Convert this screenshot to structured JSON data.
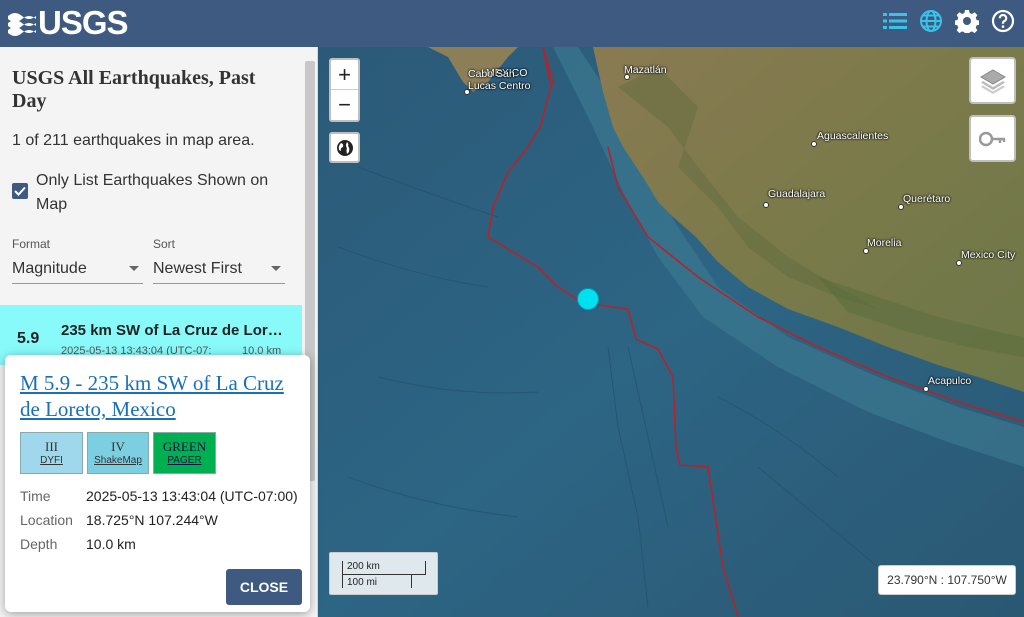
{
  "header": {
    "logo_text": "USGS",
    "icons": [
      "list-icon",
      "globe-icon",
      "gear-icon",
      "help-icon"
    ]
  },
  "sidebar": {
    "title": "USGS All Earthquakes, Past Day",
    "count_text": "1 of 211 earthquakes in map area.",
    "checkbox_label": "Only List Earthquakes Shown on Map",
    "checkbox_checked": true,
    "format_label": "Format",
    "format_value": "Magnitude",
    "sort_label": "Sort",
    "sort_value": "Newest First",
    "item": {
      "mag": "5.9",
      "place": "235 km SW of La Cruz de Loreto, Mexico",
      "time": "2025-05-13 13:43:04 (UTC-07:",
      "depth": "10.0 km"
    }
  },
  "popup": {
    "title": "M 5.9 - 235 km SW of La Cruz de Loreto, Mexico",
    "badges": [
      {
        "value": "III",
        "label": "DYFI",
        "color": "#9fd8ec"
      },
      {
        "value": "IV",
        "label": "ShakeMap",
        "color": "#7ccfe0"
      },
      {
        "value": "GREEN",
        "label": "PAGER",
        "color": "#00b050"
      }
    ],
    "rows": [
      {
        "key": "Time",
        "value": "2025-05-13 13:43:04 (UTC-07:00)"
      },
      {
        "key": "Location",
        "value": "18.725°N 107.244°W"
      },
      {
        "key": "Depth",
        "value": "10.0 km"
      }
    ],
    "close_label": "CLOSE"
  },
  "map": {
    "zoom_in": "+",
    "zoom_out": "−",
    "country_label": "MEXICO",
    "cities": [
      {
        "name": "Cabo San Lucas Centro"
      },
      {
        "name": "Mazatlán"
      },
      {
        "name": "Aguascalientes"
      },
      {
        "name": "Guadalajara"
      },
      {
        "name": "Querétaro"
      },
      {
        "name": "Morelia"
      },
      {
        "name": "Mexico City"
      },
      {
        "name": "Acapulco"
      }
    ],
    "scale_km": "200 km",
    "scale_mi": "100 mi",
    "coordinates": "23.790°N : 107.750°W"
  },
  "colors": {
    "header": "#3e5a80",
    "quake": "#00e0ee",
    "selected_item": "#88fafa",
    "plate_boundary": "#b5232a"
  }
}
